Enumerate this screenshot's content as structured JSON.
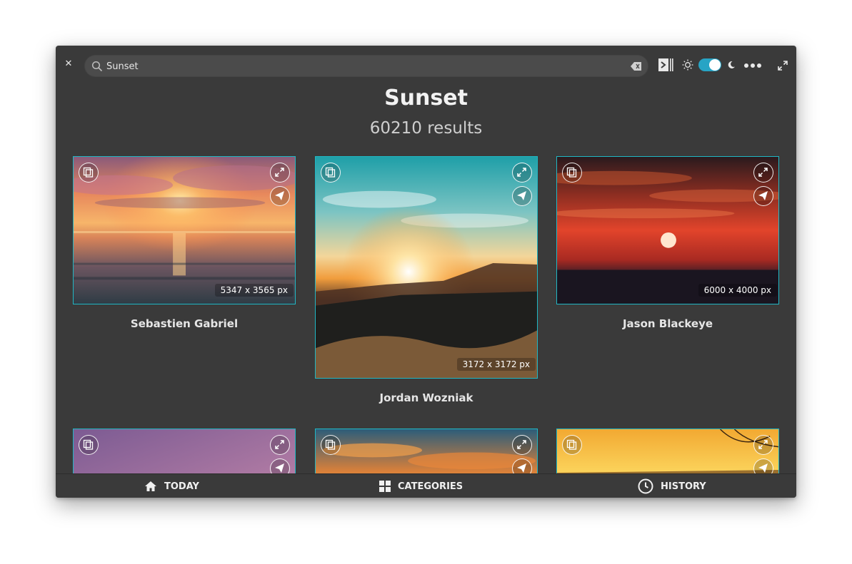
{
  "header": {
    "search_value": "Sunset"
  },
  "page": {
    "title": "Sunset",
    "results": "60210 results"
  },
  "photos": [
    {
      "author": "Sebastien Gabriel",
      "dims": "5347 x 3565  px"
    },
    {
      "author": "Jordan Wozniak",
      "dims": "3172 x 3172  px"
    },
    {
      "author": "Jason Blackeye",
      "dims": "6000 x 4000  px"
    }
  ],
  "nav": {
    "today": "TODAY",
    "categories": "CATEGORIES",
    "history": "HISTORY"
  },
  "colors": {
    "accent": "#27a4c5",
    "border": "#20b7c4",
    "background": "#3a3a3a"
  },
  "icons": [
    "close-icon",
    "search-icon",
    "clear-text-icon",
    "sidebar-toggle-icon",
    "sun-icon",
    "moon-icon",
    "more-icon",
    "fullscreen-icon",
    "copy-icon",
    "expand-icon",
    "send-icon",
    "home-icon",
    "grid-icon",
    "clock-icon"
  ]
}
